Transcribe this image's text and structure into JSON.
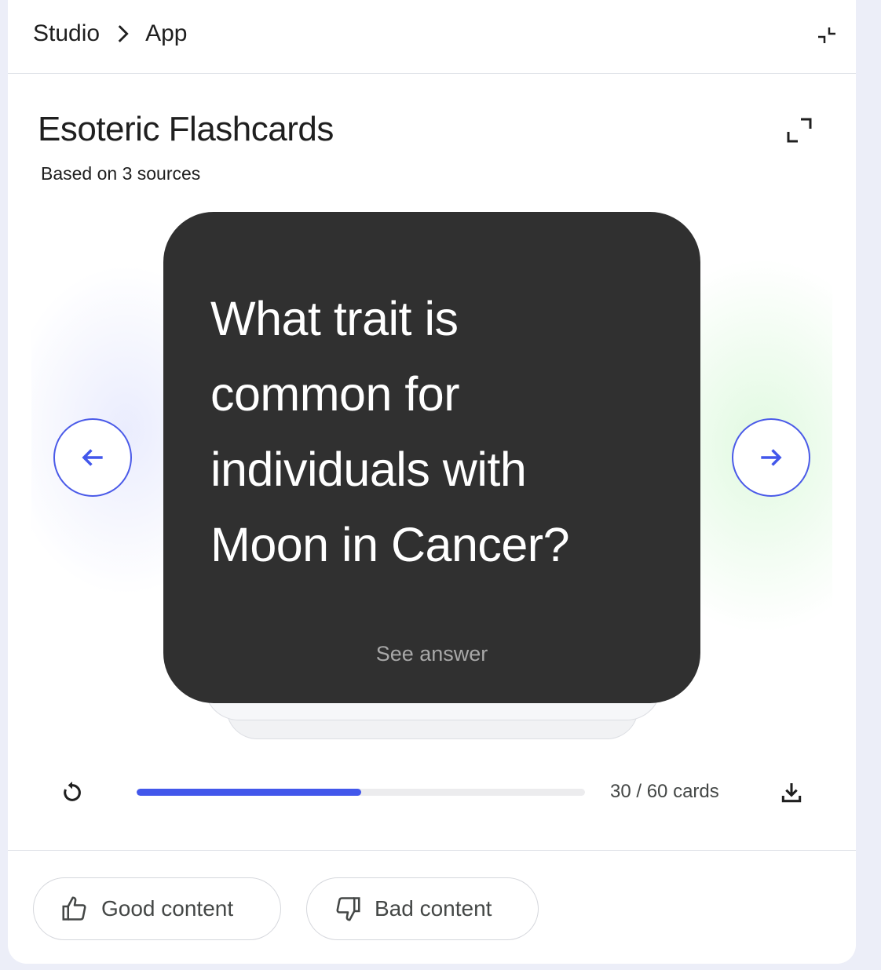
{
  "breadcrumb": {
    "parent": "Studio",
    "current": "App"
  },
  "header": {
    "collapse_icon": "collapse-icon"
  },
  "flashcards": {
    "title": "Esoteric Flashcards",
    "subtitle": "Based on 3 sources",
    "expand_icon": "expand-icon",
    "card": {
      "question": "What trait is common for individuals with Moon in Cancer?",
      "see_answer": "See answer"
    },
    "nav": {
      "prev_icon": "arrow-left-icon",
      "next_icon": "arrow-right-icon"
    },
    "progress": {
      "current": 30,
      "total": 60,
      "fraction": 0.5,
      "label": "30 / 60 cards"
    },
    "reset_icon": "restart-icon",
    "download_icon": "download-icon"
  },
  "feedback": {
    "good_label": "Good content",
    "bad_label": "Bad content"
  },
  "colors": {
    "accent": "#4257eb",
    "card_bg": "#303030",
    "page_bg": "#eceef8"
  }
}
